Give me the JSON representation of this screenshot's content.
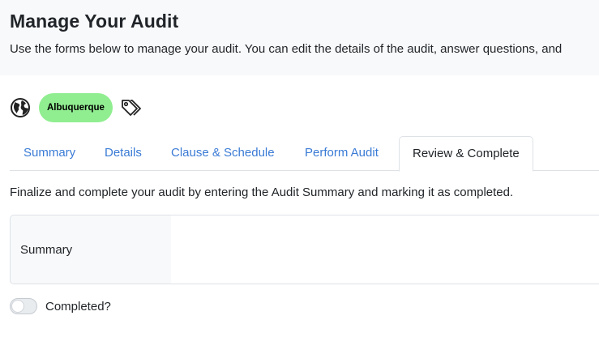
{
  "header": {
    "title": "Manage Your Audit",
    "description": "Use the forms below to manage your audit. You can edit the details of the audit, answer questions, and"
  },
  "meta": {
    "location_icon": "globe-icon",
    "location": "Albuquerque",
    "location_color": "#90ee90",
    "tags_icon": "tags-icon"
  },
  "tabs": [
    {
      "label": "Summary"
    },
    {
      "label": "Details"
    },
    {
      "label": "Clause & Schedule"
    },
    {
      "label": "Perform Audit"
    },
    {
      "label": "Review & Complete",
      "active": true
    }
  ],
  "colors": {
    "tab_link": "#3a7bd5",
    "header_bg": "#f8f9fa"
  },
  "review": {
    "instructions": "Finalize and complete your audit by entering the Audit Summary and marking it as completed.",
    "summary_label": "Summary",
    "summary_value": "",
    "completed_label": "Completed?",
    "completed": false
  }
}
